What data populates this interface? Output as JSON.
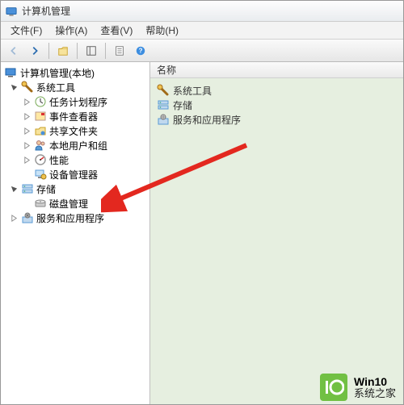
{
  "window": {
    "title": "计算机管理"
  },
  "menu": {
    "file": "文件(F)",
    "action": "操作(A)",
    "view": "查看(V)",
    "help": "帮助(H)"
  },
  "tree": {
    "root_label": "计算机管理(本地)",
    "sys_tools": "系统工具",
    "task_scheduler": "任务计划程序",
    "event_viewer": "事件查看器",
    "shared_folders": "共享文件夹",
    "local_users": "本地用户和组",
    "performance": "性能",
    "device_manager": "设备管理器",
    "storage": "存储",
    "disk_mgmt": "磁盘管理",
    "services_apps": "服务和应用程序"
  },
  "list": {
    "header_name": "名称",
    "items": [
      {
        "label": "系统工具"
      },
      {
        "label": "存储"
      },
      {
        "label": "服务和应用程序"
      }
    ]
  },
  "logo": {
    "brand": "Win10",
    "site": "系统之家"
  }
}
